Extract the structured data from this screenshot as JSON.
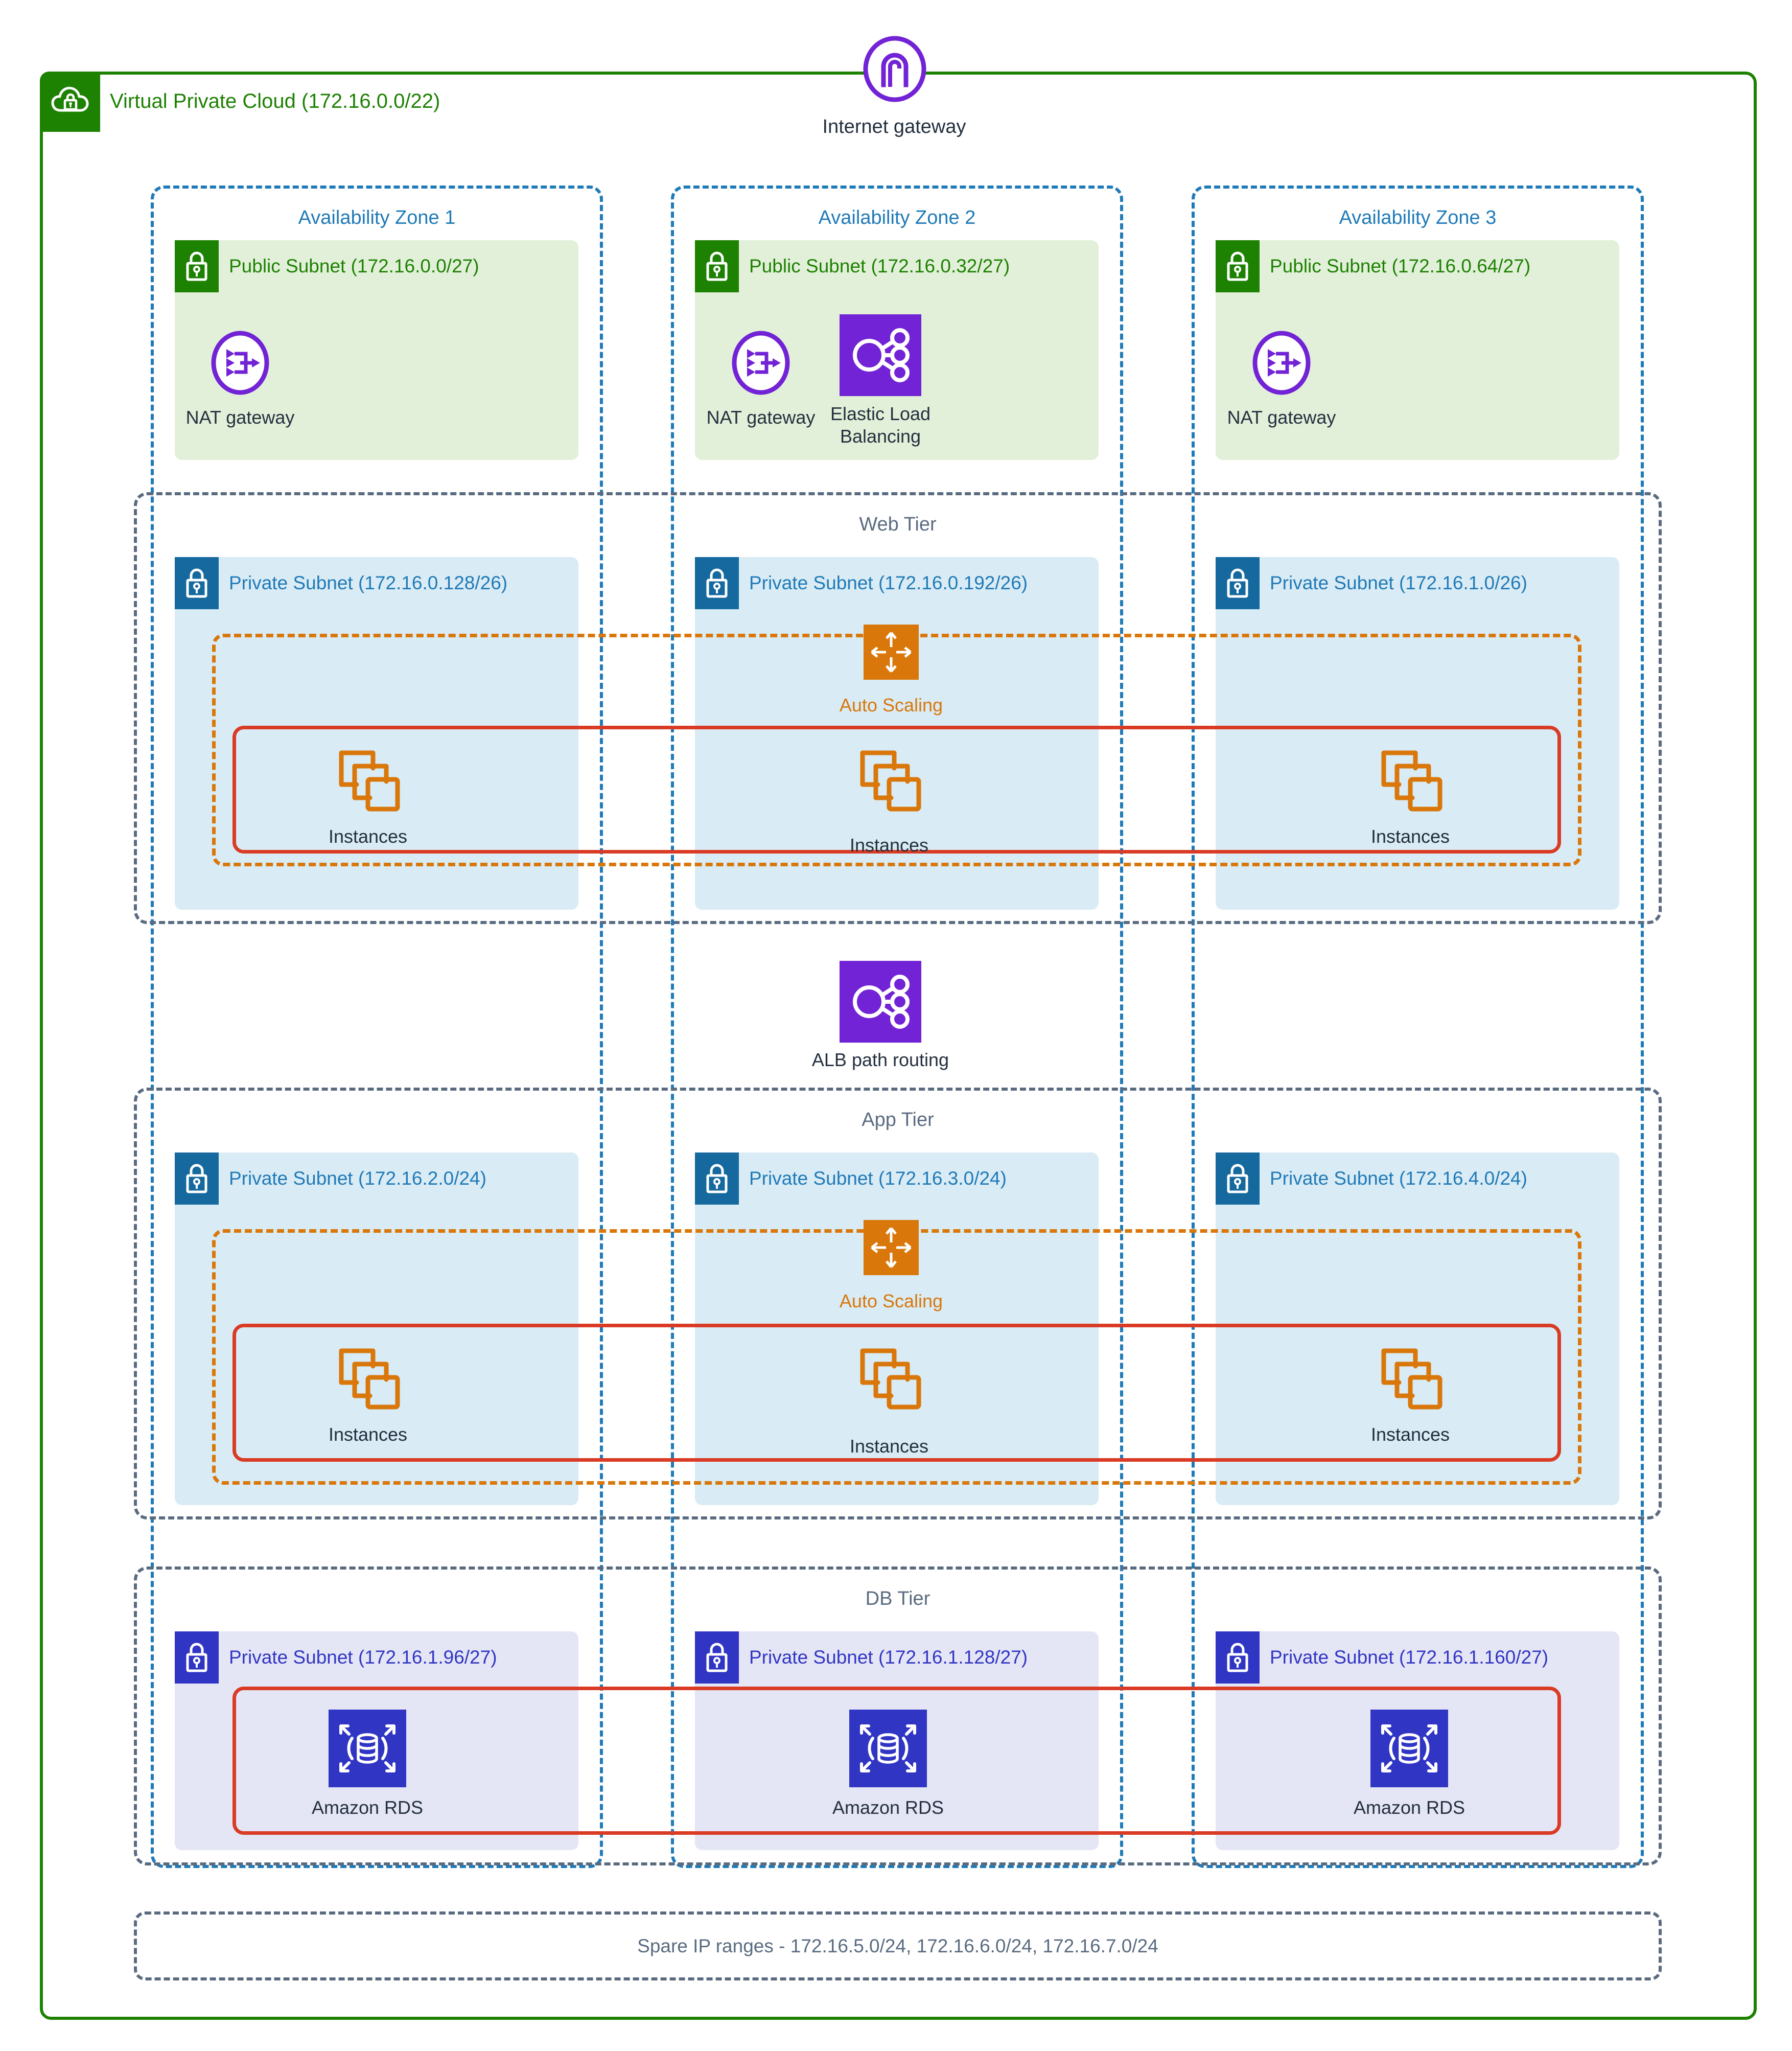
{
  "vpc": {
    "title": "Virtual Private Cloud (172.16.0.0/22)",
    "icon": "vpc-cloud-lock-icon",
    "accent": "#1d8102"
  },
  "internet_gateway": {
    "label": "Internet gateway",
    "icon": "internet-gateway-icon",
    "color": "#7223d6"
  },
  "availability_zones": [
    {
      "title": "Availability Zone 1"
    },
    {
      "title": "Availability Zone 2"
    },
    {
      "title": "Availability Zone 3"
    }
  ],
  "public_subnets": [
    {
      "label": "Public Subnet (172.16.0.0/27)"
    },
    {
      "label": "Public Subnet (172.16.0.32/27)"
    },
    {
      "label": "Public Subnet (172.16.0.64/27)"
    }
  ],
  "nat_gateways": [
    {
      "label": "NAT gateway"
    },
    {
      "label": "NAT gateway"
    },
    {
      "label": "NAT gateway"
    }
  ],
  "elastic_load_balancing": {
    "label_line1": "Elastic Load",
    "label_line2": "Balancing",
    "color": "#7223d6"
  },
  "alb_path_routing": {
    "label": "ALB path routing",
    "color": "#7223d6"
  },
  "tiers": [
    {
      "title": "Web Tier",
      "subnets": [
        {
          "label": "Private Subnet (172.16.0.128/26)"
        },
        {
          "label": "Private Subnet (172.16.0.192/26)"
        },
        {
          "label": "Private Subnet (172.16.1.0/26)"
        }
      ],
      "auto_scaling": {
        "label": "Auto Scaling",
        "color": "#d9770b"
      },
      "instances": [
        {
          "label": "Instances"
        },
        {
          "label": "Instances"
        },
        {
          "label": "Instances"
        }
      ]
    },
    {
      "title": "App Tier",
      "subnets": [
        {
          "label": "Private Subnet (172.16.2.0/24)"
        },
        {
          "label": "Private Subnet (172.16.3.0/24)"
        },
        {
          "label": "Private Subnet (172.16.4.0/24)"
        }
      ],
      "auto_scaling": {
        "label": "Auto Scaling",
        "color": "#d9770b"
      },
      "instances": [
        {
          "label": "Instances"
        },
        {
          "label": "Instances"
        },
        {
          "label": "Instances"
        }
      ]
    },
    {
      "title": "DB Tier",
      "subnets": [
        {
          "label": "Private Subnet (172.16.1.96/27)"
        },
        {
          "label": "Private Subnet (172.16.1.128/27)"
        },
        {
          "label": "Private Subnet (172.16.1.160/27)"
        }
      ],
      "databases": [
        {
          "label": "Amazon RDS"
        },
        {
          "label": "Amazon RDS"
        },
        {
          "label": "Amazon RDS"
        }
      ]
    }
  ],
  "spare_ip_ranges": {
    "text": "Spare IP ranges - 172.16.5.0/24, 172.16.6.0/24, 172.16.7.0/24"
  },
  "colors": {
    "vpc_green": "#1d8102",
    "az_blue": "#1f7ab8",
    "tier_slate": "#5a6b80",
    "autoscaling_orange": "#d9770b",
    "security_group_red": "#d93b25",
    "aws_purple": "#7223d6",
    "rds_indigo": "#3135c4",
    "connector_gray": "#545b64"
  }
}
